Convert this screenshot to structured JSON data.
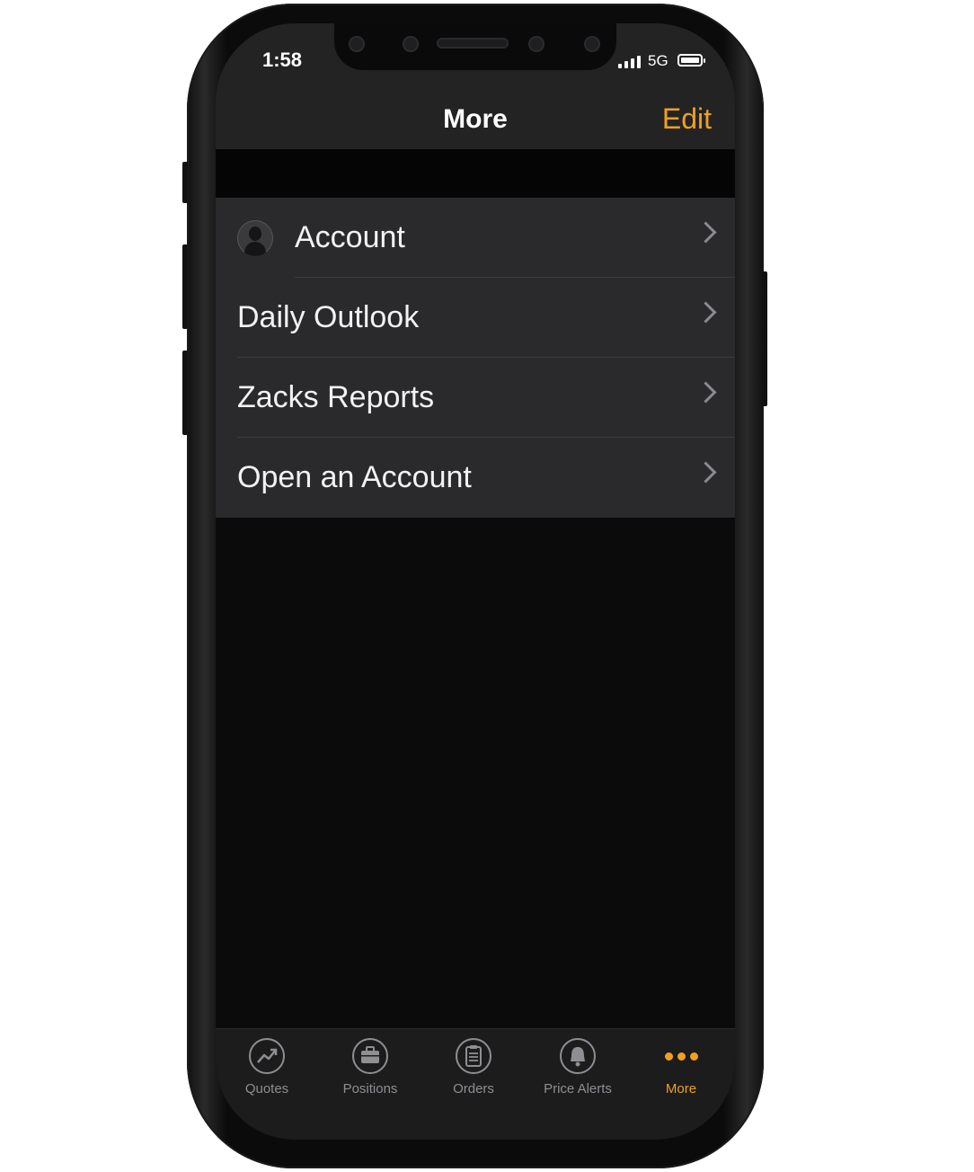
{
  "status_bar": {
    "time": "1:58",
    "network": "5G"
  },
  "nav": {
    "title": "More",
    "edit_label": "Edit"
  },
  "menu": {
    "items": [
      {
        "label": "Account",
        "icon": "user-avatar-icon"
      },
      {
        "label": "Daily Outlook"
      },
      {
        "label": "Zacks Reports"
      },
      {
        "label": "Open an Account"
      }
    ]
  },
  "tabbar": {
    "tabs": [
      {
        "label": "Quotes",
        "icon": "chart-trend-icon"
      },
      {
        "label": "Positions",
        "icon": "briefcase-icon"
      },
      {
        "label": "Orders",
        "icon": "clipboard-icon"
      },
      {
        "label": "Price Alerts",
        "icon": "bell-icon"
      },
      {
        "label": "More",
        "icon": "more-dots-icon",
        "active": true
      }
    ]
  },
  "colors": {
    "accent": "#f0a01e",
    "background": "#0b0b0c",
    "row": "#2a2a2c"
  }
}
